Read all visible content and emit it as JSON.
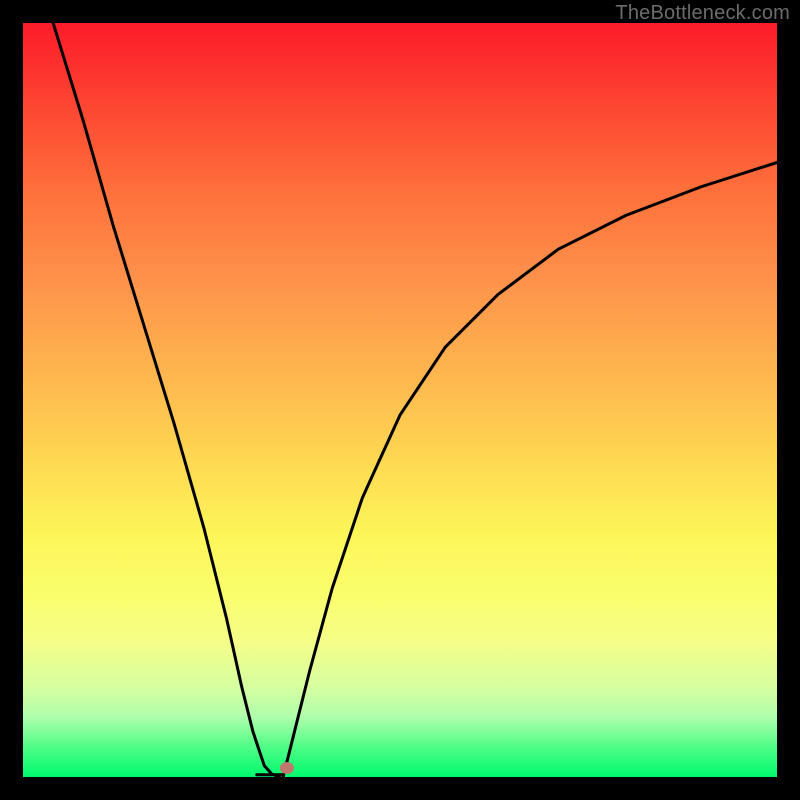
{
  "watermark": "TheBottleneck.com",
  "chart_data": {
    "type": "line",
    "title": "",
    "xlabel": "",
    "ylabel": "",
    "xlim": [
      0,
      100
    ],
    "ylim": [
      0,
      100
    ],
    "series": [
      {
        "name": "curve-left",
        "x": [
          4,
          8,
          12,
          16,
          20,
          24,
          27,
          29,
          30.5,
          31.5,
          32,
          33,
          34
        ],
        "y": [
          100,
          87,
          73,
          60,
          47,
          33,
          21,
          12,
          6,
          3,
          1.5,
          0.4,
          0
        ]
      },
      {
        "name": "valley-floor",
        "x": [
          31,
          34.5
        ],
        "y": [
          0.3,
          0.3
        ]
      },
      {
        "name": "curve-right",
        "x": [
          34.5,
          36,
          38,
          41,
          45,
          50,
          56,
          63,
          71,
          80,
          90,
          100
        ],
        "y": [
          0,
          6,
          14,
          25,
          37,
          48,
          57,
          64,
          70,
          74.5,
          78.3,
          81.5
        ]
      }
    ],
    "marker": {
      "x": 35,
      "y": 1.2,
      "color": "#c0776e"
    }
  }
}
